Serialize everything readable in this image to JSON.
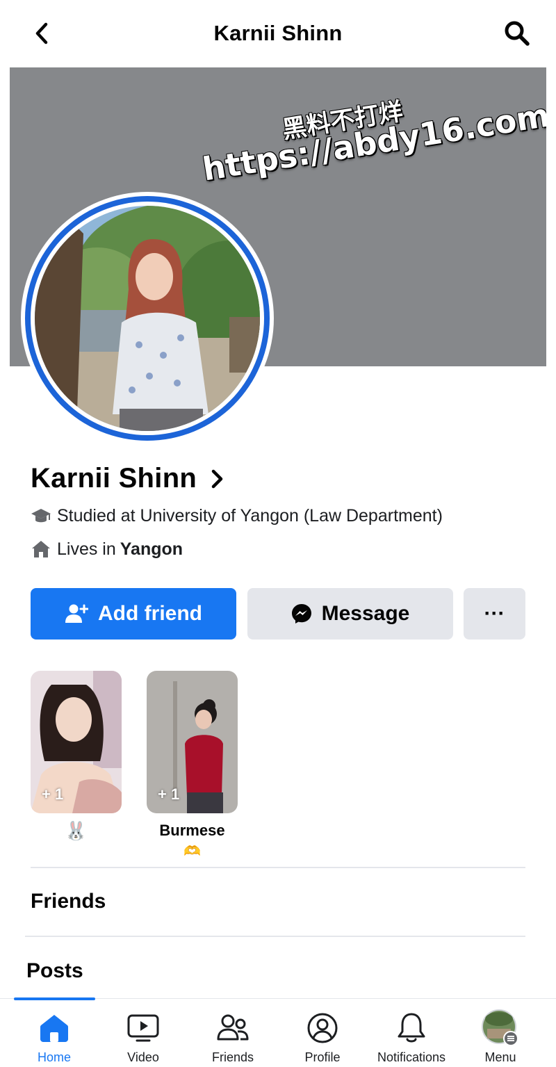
{
  "header": {
    "title": "Karnii Shinn",
    "back_icon": "chevron-left-icon",
    "search_icon": "search-icon"
  },
  "cover": {
    "watermark_line1": "黑料不打烊",
    "watermark_line2": "https://abdy16.com",
    "color": "#86888b"
  },
  "profile": {
    "name": "Karnii Shinn",
    "education_text": "Studied at University of Yangon (Law Department)",
    "lives_prefix": "Lives in",
    "lives_city": "Yangon"
  },
  "actions": {
    "add_friend_label": "Add friend",
    "message_label": "Message",
    "more_label": "···"
  },
  "highlights": [
    {
      "count": "+ 1",
      "caption": "🐰"
    },
    {
      "count": "+ 1",
      "caption": "Burmese",
      "caption_emoji": "🫶"
    }
  ],
  "sections": {
    "friends_title": "Friends",
    "posts_title": "Posts"
  },
  "bottom_nav": [
    {
      "label": "Home",
      "icon": "home-icon",
      "active": true
    },
    {
      "label": "Video",
      "icon": "video-icon",
      "active": false
    },
    {
      "label": "Friends",
      "icon": "friends-icon",
      "active": false
    },
    {
      "label": "Profile",
      "icon": "profile-icon",
      "active": false
    },
    {
      "label": "Notifications",
      "icon": "bell-icon",
      "active": false
    },
    {
      "label": "Menu",
      "icon": "menu-avatar-icon",
      "active": false
    }
  ],
  "colors": {
    "accent": "#1877f2",
    "ring": "#1c64d8",
    "secondary_button": "#e4e6eb"
  }
}
